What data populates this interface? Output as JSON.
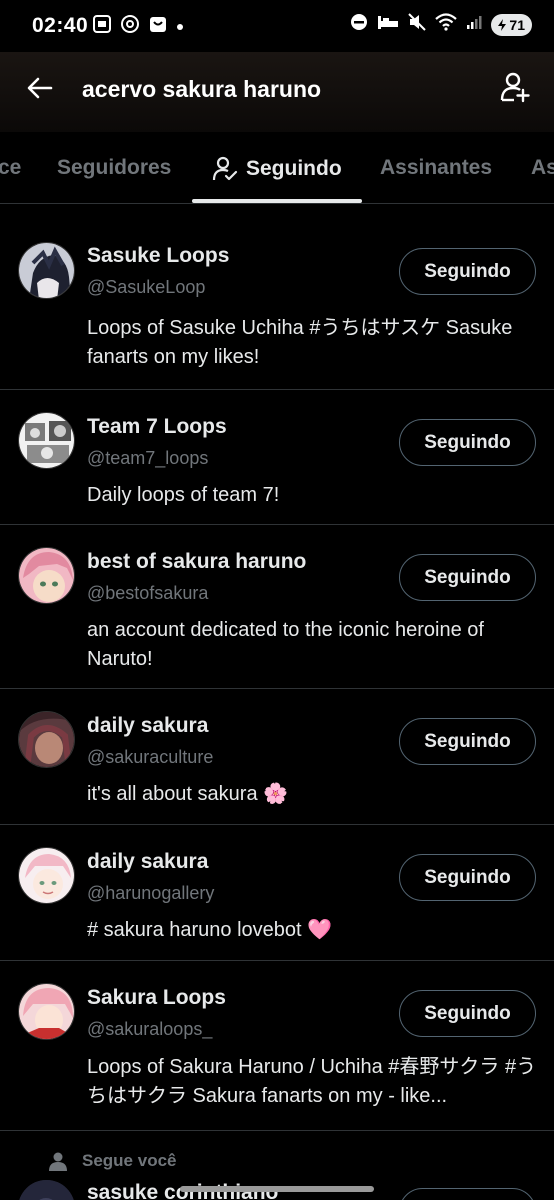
{
  "status_bar": {
    "time": "02:40",
    "battery": "71"
  },
  "header": {
    "title": "acervo sakura haruno"
  },
  "tabs": [
    {
      "label": "ce"
    },
    {
      "label": "Seguidores"
    },
    {
      "label": "Seguindo",
      "active": true
    },
    {
      "label": "Assinantes"
    },
    {
      "label": "As"
    }
  ],
  "accounts": [
    {
      "name": "Sasuke Loops",
      "handle": "@SasukeLoop",
      "bio": "Loops of Sasuke Uchiha #うちはサスケ Sasuke fanarts on my likes!",
      "button": "Seguindo"
    },
    {
      "name": "Team 7 Loops",
      "handle": "@team7_loops",
      "bio": "Daily loops of team 7!",
      "button": "Seguindo"
    },
    {
      "name": "best of sakura haruno",
      "handle": "@bestofsakura",
      "bio": "an account dedicated to the iconic heroine of Naruto!",
      "button": "Seguindo"
    },
    {
      "name": "daily sakura",
      "handle": "@sakuraculture",
      "bio": "it's all about sakura 🌸",
      "button": "Seguindo"
    },
    {
      "name": "daily sakura",
      "handle": "@harunogallery",
      "bio": "# sakura haruno lovebot 🩷",
      "button": "Seguindo"
    },
    {
      "name": "Sakura Loops",
      "handle": "@sakuraloops_",
      "bio": "Loops of Sakura Haruno / Uchiha #春野サクラ #うちはサクラ Sakura fanarts on my - like...",
      "button": "Seguindo"
    }
  ],
  "partial": {
    "follows_you": "Segue você",
    "name": "sasuke corinthiano"
  },
  "colors": {
    "background": "#000000",
    "text": "#e7e9ea",
    "muted": "#71767b",
    "border": "#2f3336"
  }
}
